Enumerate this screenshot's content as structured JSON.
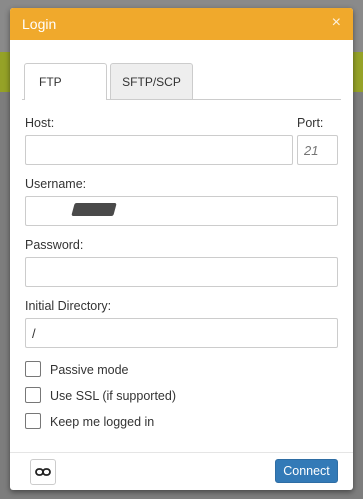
{
  "dialog": {
    "title": "Login",
    "close_glyph": "×"
  },
  "tabs": [
    {
      "label": "FTP",
      "active": true
    },
    {
      "label": "SFTP/SCP",
      "active": false
    }
  ],
  "form": {
    "host_label": "Host:",
    "host_value": "",
    "port_label": "Port:",
    "port_placeholder": "21",
    "username_label": "Username:",
    "username_value": "",
    "password_label": "Password:",
    "password_value": "",
    "initial_dir_label": "Initial Directory:",
    "initial_dir_value": "/"
  },
  "options": [
    {
      "label": "Passive mode",
      "checked": false
    },
    {
      "label": "Use SSL (if supported)",
      "checked": false
    },
    {
      "label": "Keep me logged in",
      "checked": false
    }
  ],
  "footer": {
    "link_icon": "link-icon",
    "connect_label": "Connect"
  },
  "colors": {
    "header": "#f0a92c",
    "primary_button": "#337ab7"
  }
}
